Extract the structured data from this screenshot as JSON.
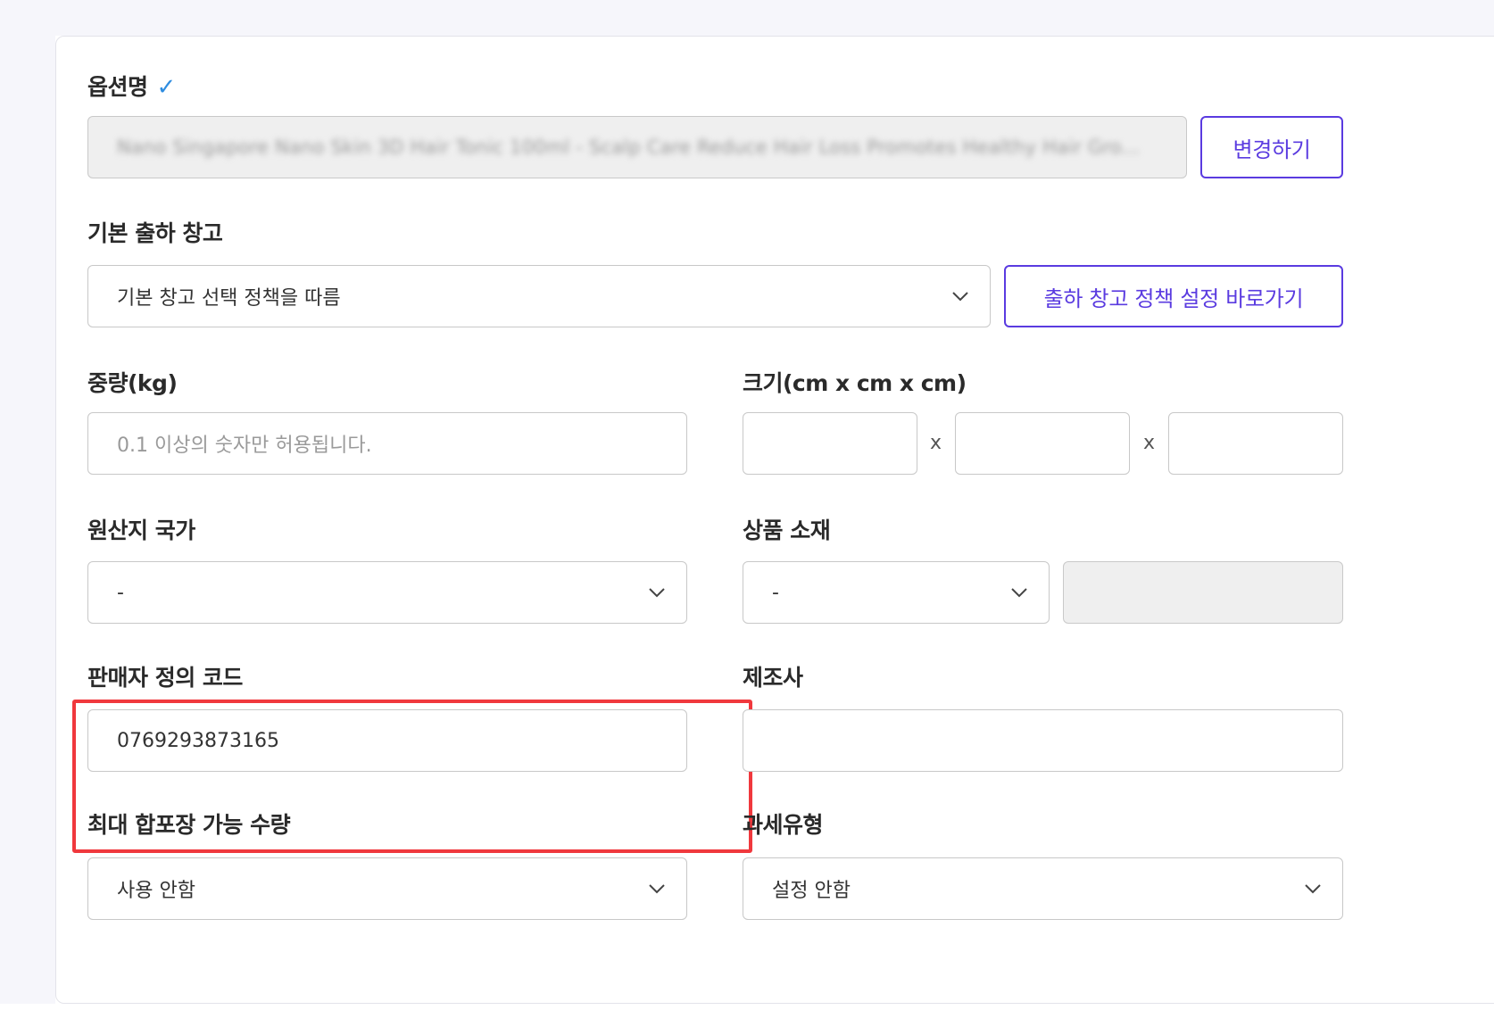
{
  "option_name": {
    "label": "옵션명",
    "verified_icon": "check-icon",
    "value": "Nano Singapore Nano Skin 3D Hair Tonic 100ml - Scalp Care Reduce Hair Loss Promotes Healthy Hair Gro...",
    "change_button": "변경하기"
  },
  "warehouse": {
    "label": "기본 출하 창고",
    "selected": "기본 창고 선택 정책을 따름",
    "shortcut_button": "출하 창고 정책 설정 바로가기"
  },
  "weight": {
    "label": "중량(kg)",
    "placeholder": "0.1 이상의 숫자만 허용됩니다."
  },
  "size": {
    "label": "크기(cm x cm x cm)",
    "separator": "x",
    "values": [
      "",
      "",
      ""
    ]
  },
  "origin_country": {
    "label": "원산지 국가",
    "selected": "-"
  },
  "material": {
    "label": "상품 소재",
    "selected": "-",
    "detail": ""
  },
  "seller_code": {
    "label": "판매자 정의 코드",
    "value": "0769293873165",
    "highlight_color": "#f0383d"
  },
  "manufacturer": {
    "label": "제조사",
    "value": ""
  },
  "max_bundle_qty": {
    "label": "최대 합포장 가능 수량",
    "selected": "사용 안함"
  },
  "tax_type": {
    "label": "과세유형",
    "selected": "설정 안함"
  },
  "colors": {
    "accent": "#5a3be0",
    "check": "#2f8de0",
    "border": "#c8c8c8",
    "readonly_bg": "#efefef"
  }
}
